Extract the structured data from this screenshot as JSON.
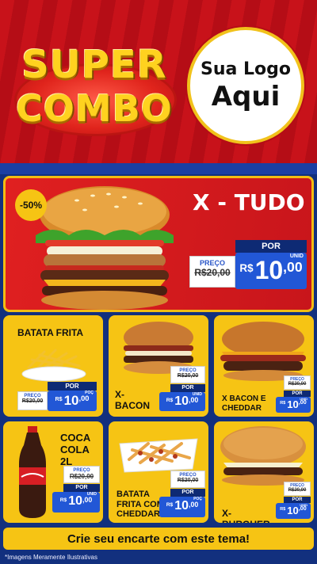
{
  "header": {
    "title_line1": "SUPER",
    "title_line2": "COMBO",
    "logo_line1": "Sua Logo",
    "logo_line2": "Aqui"
  },
  "featured": {
    "discount": "-50%",
    "name": "X - TUDO",
    "preco_label": "PREÇO",
    "por_label": "POR",
    "old_price": "R$20,00",
    "currency": "R$",
    "price_int": "10",
    "price_cents": ",00",
    "unit": "UNID"
  },
  "items": [
    {
      "name": "BATATA FRITA",
      "preco_label": "PREÇO",
      "por_label": "POR",
      "old_price": "R$20,00",
      "currency": "R$",
      "price_int": "10",
      "price_cents": ",00",
      "unit": "POÇ"
    },
    {
      "name": "X- BACON",
      "preco_label": "PREÇO",
      "por_label": "POR",
      "old_price": "R$20,00",
      "currency": "R$",
      "price_int": "10",
      "price_cents": ",00",
      "unit": "UNID"
    },
    {
      "name": "X BACON E CHEDDAR",
      "preco_label": "PREÇO",
      "por_label": "POR",
      "old_price": "R$20,00",
      "currency": "R$",
      "price_int": "10",
      "price_cents": ",00",
      "unit": "UNID"
    },
    {
      "name": "COCA COLA 2L",
      "preco_label": "PREÇO",
      "por_label": "POR",
      "old_price": "R$20,00",
      "currency": "R$",
      "price_int": "10",
      "price_cents": ",00",
      "unit": "UNID"
    },
    {
      "name": "BATATA FRITA COM CHEDDAR",
      "preco_label": "PREÇO",
      "por_label": "POR",
      "old_price": "R$20,00",
      "currency": "R$",
      "price_int": "10",
      "price_cents": ",00",
      "unit": "POÇ"
    },
    {
      "name": "X-BURGUER",
      "preco_label": "PREÇO",
      "por_label": "POR",
      "old_price": "R$20,00",
      "currency": "R$",
      "price_int": "10",
      "price_cents": ",00",
      "unit": "UNID"
    }
  ],
  "footer": {
    "cta": "Crie seu encarte com este tema!",
    "disclaimer": "*Imagens Meramente Ilustrativas"
  },
  "colors": {
    "header_red": "#c8121a",
    "background_blue": "#12307e",
    "card_yellow": "#f6c414",
    "price_blue": "#2257d6",
    "title_gold": "#ffd21f"
  }
}
